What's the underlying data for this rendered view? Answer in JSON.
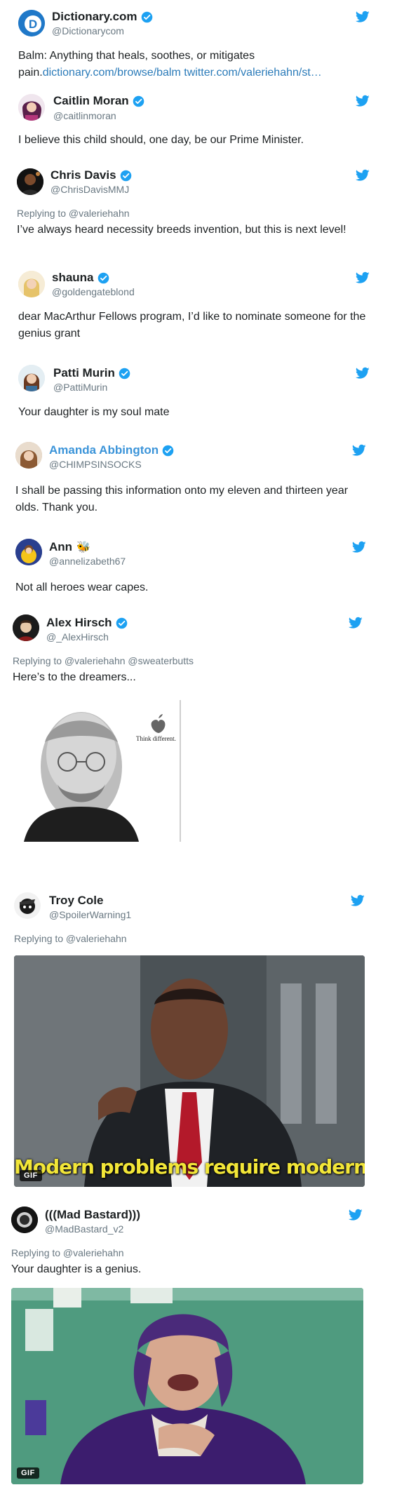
{
  "tweets": [
    {
      "name": "Dictionary.com",
      "handle": "@Dictionarycom",
      "text": "Balm: Anything that heals, soothes, or mitigates pain.",
      "link1": "dictionary.com/browse/balm",
      "link2": "twitter.com/valeriehahn/st…"
    },
    {
      "name": "Caitlin Moran",
      "handle": "@caitlinmoran",
      "text": "I believe this child should, one day, be our Prime Minister."
    },
    {
      "name": "Chris Davis",
      "handle": "@ChrisDavisMMJ",
      "reply": "Replying to @valeriehahn",
      "text": "I’ve always heard necessity breeds invention, but this is next level!"
    },
    {
      "name": "shauna",
      "handle": "@goldengateblond",
      "text": "dear MacArthur Fellows program, I’d like to nominate someone for the genius grant"
    },
    {
      "name": "Patti Murin",
      "handle": "@PattiMurin",
      "text": "Your daughter is my soul mate"
    },
    {
      "name": "Amanda Abbington",
      "handle": "@CHIMPSINSOCKS",
      "text": "I shall be passing this information onto my eleven and thirteen year olds. Thank you."
    },
    {
      "name": "Ann",
      "handle": "@annelizabeth67",
      "text": "Not all heroes wear capes.",
      "emoji": "🐝"
    },
    {
      "name": "Alex Hirsch",
      "handle": "@_AlexHirsch",
      "reply": "Replying to @valeriehahn @sweaterbutts",
      "text": "Here’s to the dreamers...",
      "image_text": "Think different."
    },
    {
      "name": "Troy Cole",
      "handle": "@SpoilerWarning1",
      "reply": "Replying to @valeriehahn",
      "gif_label": "GIF",
      "caption": "Modern problems require modern solutions"
    },
    {
      "name": "(((Mad Bastard)))",
      "handle": "@MadBastard_v2",
      "reply": "Replying to @valeriehahn",
      "text": "Your daughter is a genius.",
      "gif_label": "GIF"
    }
  ],
  "colors": {
    "brand": "#1da1f2",
    "link": "#2b7bb9",
    "name_highlight": "#3b94d9",
    "muted": "#697882"
  },
  "icons": {
    "verified": "verified-badge-icon",
    "platform": "twitter-bird-icon"
  }
}
